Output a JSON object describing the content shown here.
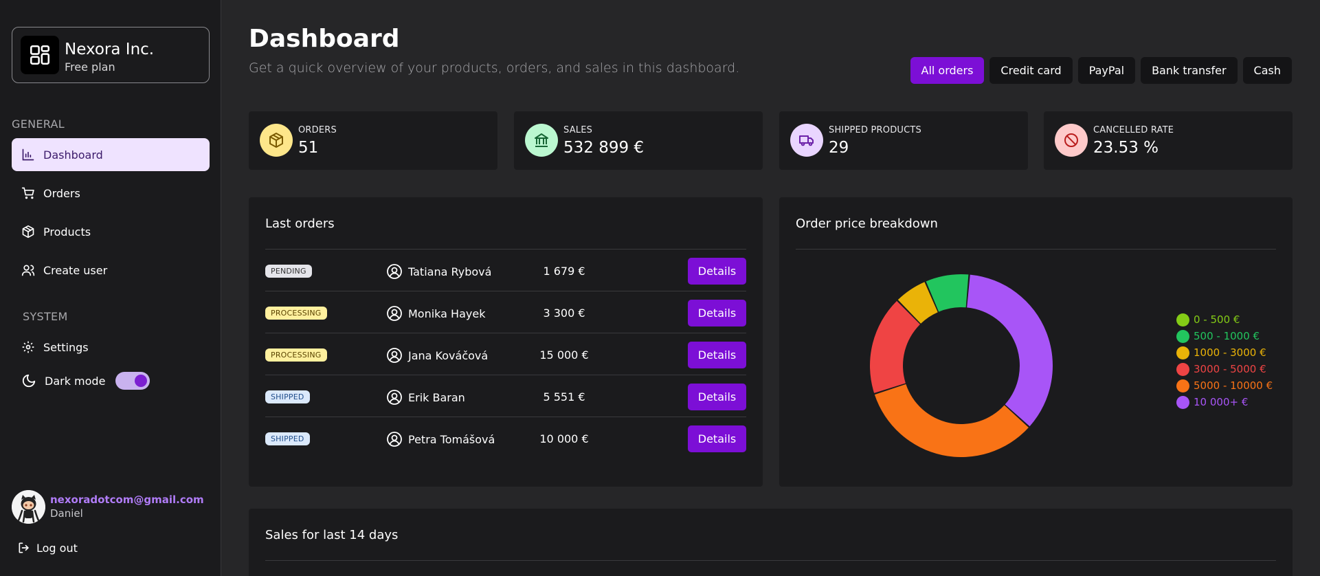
{
  "brand": {
    "name": "Nexora Inc.",
    "plan": "Free plan"
  },
  "sidebar": {
    "general_label": "GENERAL",
    "system_label": "SYSTEM",
    "items": [
      {
        "label": "Dashboard",
        "icon": "chart-bar-icon",
        "active": true
      },
      {
        "label": "Orders",
        "icon": "shopping-cart-icon"
      },
      {
        "label": "Products",
        "icon": "package-icon"
      },
      {
        "label": "Create user",
        "icon": "user-plus-icon"
      }
    ],
    "settings_label": "Settings",
    "dark_mode_label": "Dark mode",
    "dark_mode_on": true
  },
  "user": {
    "email": "nexoradotcom@gmail.com",
    "name": "Daniel"
  },
  "logout_label": "Log out",
  "header": {
    "title": "Dashboard",
    "subtitle": "Get a quick overview of your products, orders, and sales in this dashboard."
  },
  "filters": [
    {
      "label": "All orders",
      "active": true
    },
    {
      "label": "Credit card"
    },
    {
      "label": "PayPal"
    },
    {
      "label": "Bank transfer"
    },
    {
      "label": "Cash"
    }
  ],
  "kpis": [
    {
      "label": "ORDERS",
      "value": "51",
      "icon": "box-icon",
      "icon_bg": "#fde68a",
      "icon_color": "#7a5a00"
    },
    {
      "label": "SALES",
      "value": "532 899 €",
      "icon": "bank-icon",
      "icon_bg": "#bbf7d0",
      "icon_color": "#166534"
    },
    {
      "label": "SHIPPED PRODUCTS",
      "value": "29",
      "icon": "truck-icon",
      "icon_bg": "#e9d5ff",
      "icon_color": "#6b21a8"
    },
    {
      "label": "CANCELLED RATE",
      "value": "23.53 %",
      "icon": "ban-icon",
      "icon_bg": "#fecaca",
      "icon_color": "#b91c1c"
    }
  ],
  "last_orders": {
    "title": "Last orders",
    "details_label": "Details",
    "rows": [
      {
        "status": "PENDING",
        "status_kind": "pending",
        "customer": "Tatiana Rybová",
        "price": "1 679 €"
      },
      {
        "status": "PROCESSING",
        "status_kind": "processing",
        "customer": "Monika Hayek",
        "price": "3 300 €"
      },
      {
        "status": "PROCESSING",
        "status_kind": "processing",
        "customer": "Jana Kováčová",
        "price": "15 000 €"
      },
      {
        "status": "SHIPPED",
        "status_kind": "shipped",
        "customer": "Erik Baran",
        "price": "5 551 €"
      },
      {
        "status": "SHIPPED",
        "status_kind": "shipped",
        "customer": "Petra Tomášová",
        "price": "10 000 €"
      }
    ]
  },
  "breakdown": {
    "title": "Order price breakdown"
  },
  "sales": {
    "title": "Sales for last 14 days"
  },
  "chart_data": {
    "type": "pie",
    "title": "Order price breakdown",
    "categories": [
      "0 - 500 €",
      "500 - 1000 €",
      "1000 - 3000 €",
      "3000 - 5000 €",
      "5000 - 10000 €",
      "10 000+ €"
    ],
    "values": [
      0,
      4,
      3,
      9,
      17,
      18
    ],
    "colors": [
      "#84cc16",
      "#22c55e",
      "#eab308",
      "#ef4444",
      "#f97316",
      "#a855f7"
    ],
    "legend": "right"
  }
}
